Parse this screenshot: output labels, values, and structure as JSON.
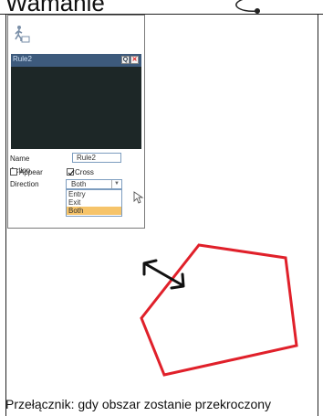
{
  "heading": "Wamanie",
  "panel": {
    "rule_title": "Rule2",
    "search_btn": "Q",
    "close_btn": "✕",
    "name_label": "Name",
    "name_value": "Rule2",
    "action_label": "Action",
    "appear_label": "Appear",
    "cross_label": "Cross",
    "appear_checked": false,
    "cross_checked": true,
    "direction_label": "Direction",
    "direction_value": "Both",
    "direction_options": [
      "Entry",
      "Exit",
      "Both"
    ]
  },
  "caption": "Przełącznik: gdy obszar zostanie przekroczony",
  "colors": {
    "polygon": "#e0202a",
    "title_bar": "#3d5a7c",
    "video": "#1d2727",
    "selected_option": "#f6c46a"
  }
}
